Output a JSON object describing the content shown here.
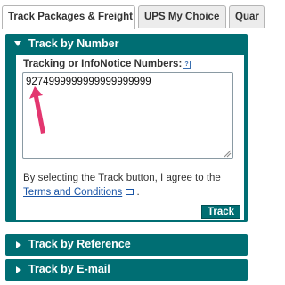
{
  "tabs": [
    {
      "label": "Track Packages & Freight",
      "active": true
    },
    {
      "label": "UPS My Choice",
      "active": false
    },
    {
      "label": "Quar",
      "active": false
    }
  ],
  "track_by_number": {
    "title": "Track by Number",
    "field_label": "Tracking or InfoNotice Numbers:",
    "tracking_value": "9274999999999999999999",
    "agree_text": "By selecting the Track button, I agree to the",
    "terms_link": "Terms and Conditions",
    "period": ".",
    "track_button": "Track"
  },
  "sections": [
    {
      "title": "Track by Reference"
    },
    {
      "title": "Track by E-mail"
    }
  ],
  "colors": {
    "accent": "#006e73",
    "link": "#1a55a6",
    "arrow": "#e3366f"
  },
  "icons": {
    "help": "help-icon",
    "external": "external-window-icon",
    "expand": "caret-down-icon",
    "collapse": "caret-right-icon",
    "pointer": "arrow-pointer-icon"
  }
}
